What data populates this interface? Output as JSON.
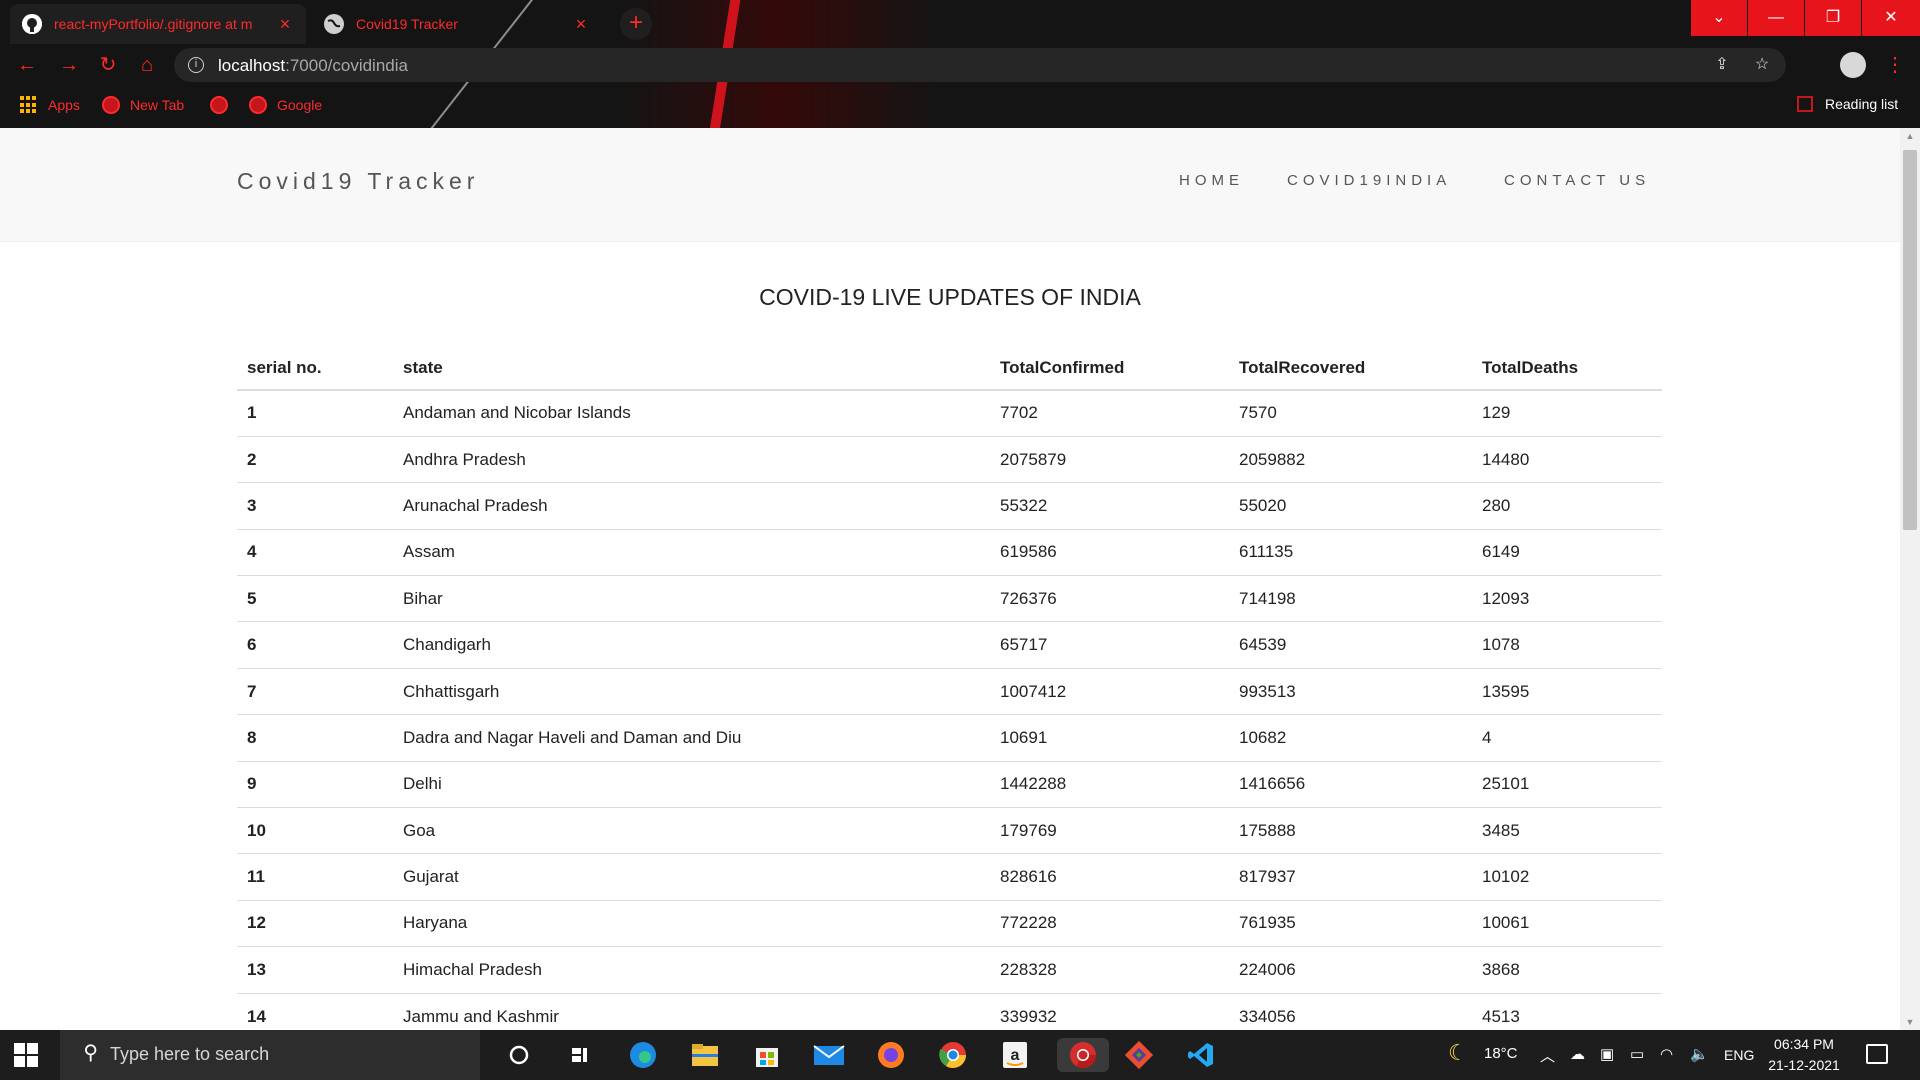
{
  "browser": {
    "tabs": [
      {
        "title": "react-myPortfolio/.gitignore at m",
        "icon": "github-icon",
        "active": true
      },
      {
        "title": "Covid19 Tracker",
        "icon": "globe-icon",
        "active": false
      }
    ],
    "new_tab_label": "+",
    "window_controls": {
      "menu": "⌄",
      "minimize": "—",
      "maximize": "❐",
      "close": "✕"
    },
    "url_host": "localhost",
    "url_rest": ":7000/covidindia",
    "bookmarks": [
      {
        "label": "Apps",
        "icon": "apps-grid-icon"
      },
      {
        "label": "New Tab",
        "icon": "chrome-icon"
      },
      {
        "label": "",
        "icon": "chrome-icon"
      },
      {
        "label": "Google",
        "icon": "chrome-icon"
      }
    ],
    "reading_list": "Reading list",
    "accent_color": "#ff2a2a"
  },
  "site": {
    "brand": "Covid19 Tracker",
    "nav": [
      "HOME",
      "COVID19INDIA",
      "CONTACT US"
    ],
    "page_title": "COVID-19 LIVE UPDATES OF INDIA",
    "table": {
      "headers": [
        "serial no.",
        "state",
        "TotalConfirmed",
        "TotalRecovered",
        "TotalDeaths"
      ],
      "rows": [
        [
          "1",
          "Andaman and Nicobar Islands",
          "7702",
          "7570",
          "129"
        ],
        [
          "2",
          "Andhra Pradesh",
          "2075879",
          "2059882",
          "14480"
        ],
        [
          "3",
          "Arunachal Pradesh",
          "55322",
          "55020",
          "280"
        ],
        [
          "4",
          "Assam",
          "619586",
          "611135",
          "6149"
        ],
        [
          "5",
          "Bihar",
          "726376",
          "714198",
          "12093"
        ],
        [
          "6",
          "Chandigarh",
          "65717",
          "64539",
          "1078"
        ],
        [
          "7",
          "Chhattisgarh",
          "1007412",
          "993513",
          "13595"
        ],
        [
          "8",
          "Dadra and Nagar Haveli and Daman and Diu",
          "10691",
          "10682",
          "4"
        ],
        [
          "9",
          "Delhi",
          "1442288",
          "1416656",
          "25101"
        ],
        [
          "10",
          "Goa",
          "179769",
          "175888",
          "3485"
        ],
        [
          "11",
          "Gujarat",
          "828616",
          "817937",
          "10102"
        ],
        [
          "12",
          "Haryana",
          "772228",
          "761935",
          "10061"
        ],
        [
          "13",
          "Himachal Pradesh",
          "228328",
          "224006",
          "3868"
        ],
        [
          "14",
          "Jammu and Kashmir",
          "339932",
          "334056",
          "4513"
        ]
      ]
    }
  },
  "taskbar": {
    "search_placeholder": "Type here to search",
    "apps": [
      "cortana-icon",
      "task-view-icon",
      "edge-icon",
      "file-explorer-icon",
      "store-icon",
      "mail-icon",
      "firefox-icon",
      "chrome-icon",
      "amazon-icon",
      "chrome-active-icon",
      "git-icon",
      "vscode-icon"
    ],
    "weather": "18°C",
    "language": "ENG",
    "time": "06:34 PM",
    "date": "21-12-2021"
  }
}
